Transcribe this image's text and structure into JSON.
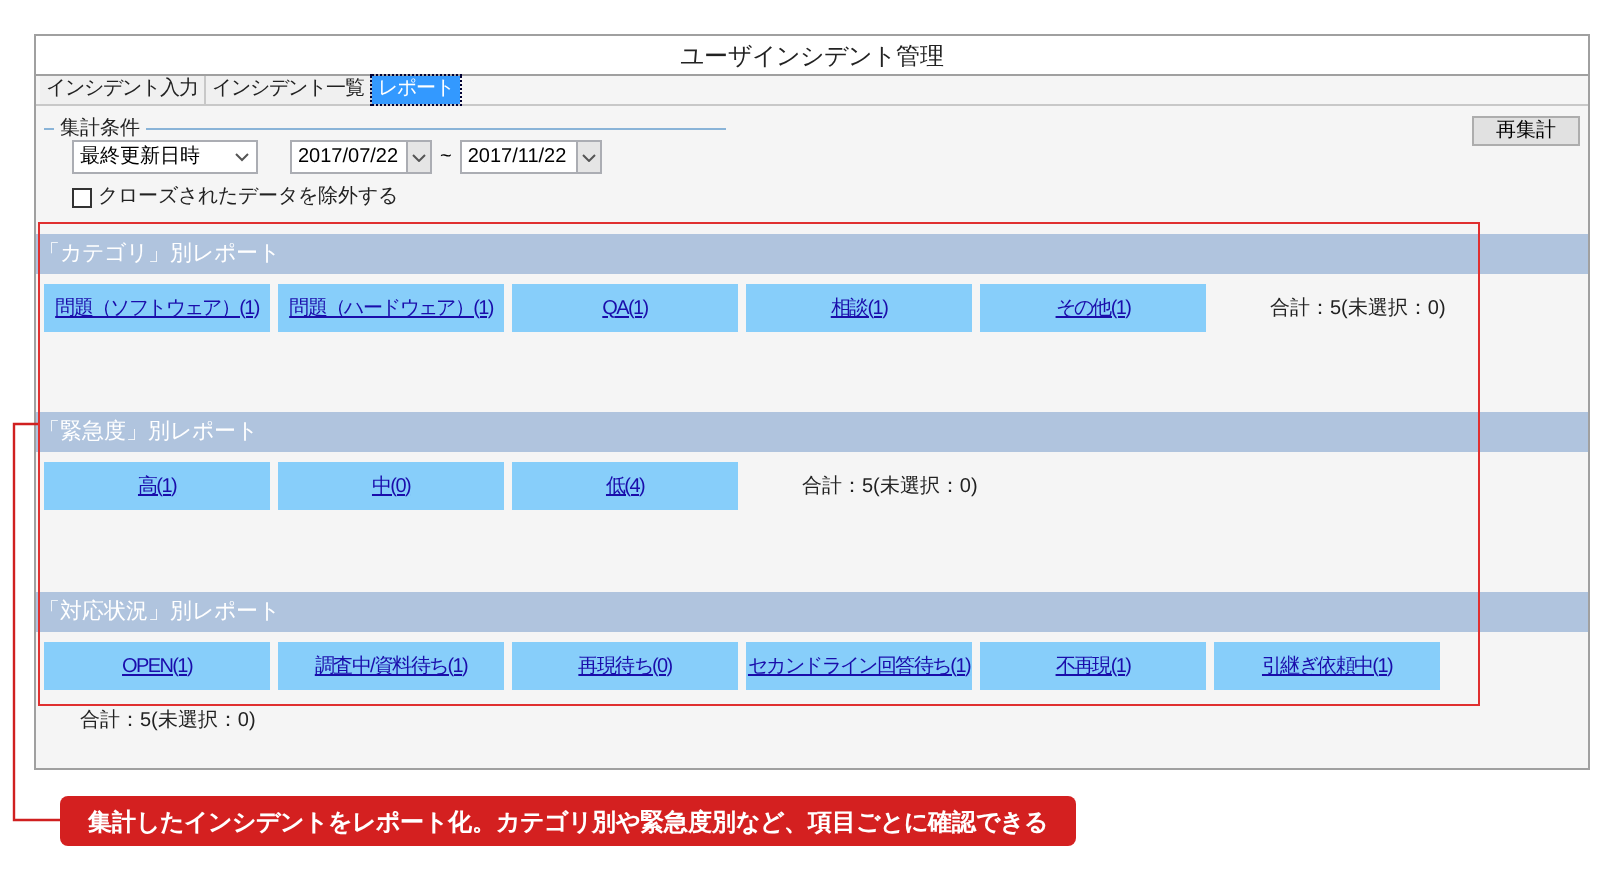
{
  "window": {
    "title": "ユーザインシデント管理"
  },
  "tabs": [
    {
      "label": "インシデント入力",
      "selected": false
    },
    {
      "label": "インシデント一覧",
      "selected": false
    },
    {
      "label": "レポート",
      "selected": true
    }
  ],
  "conditions": {
    "legend": "集計条件",
    "date_field": "最終更新日時",
    "from": "2017/07/22",
    "separator": "~",
    "to": "2017/11/22",
    "exclude_closed": {
      "label": "クローズされたデータを除外する",
      "checked": false
    },
    "recalc_button": "再集計"
  },
  "reports": [
    {
      "title": "「カテゴリ」別レポート",
      "items": [
        "問題（ソフトウェア）(1)",
        "問題（ハードウェア）(1)",
        "QA(1)",
        "相談(1)",
        "その他(1)"
      ],
      "total": "合計：5(未選択：0)",
      "total_below": false
    },
    {
      "title": "「緊急度」別レポート",
      "items": [
        "高(1)",
        "中(0)",
        "低(4)"
      ],
      "total": "合計：5(未選択：0)",
      "total_below": false
    },
    {
      "title": "「対応状況」別レポート",
      "items": [
        "OPEN(1)",
        "調査中/資料待ち(1)",
        "再現待ち(0)",
        "セカンドライン回答待ち(1)",
        "不再現(1)",
        "引継ぎ依頼中(1)"
      ],
      "total": "合計：5(未選択：0)",
      "total_below": true
    }
  ],
  "callout": "集計したインシデントをレポート化。カテゴリ別や緊急度別など、項目ごとに確認できる"
}
